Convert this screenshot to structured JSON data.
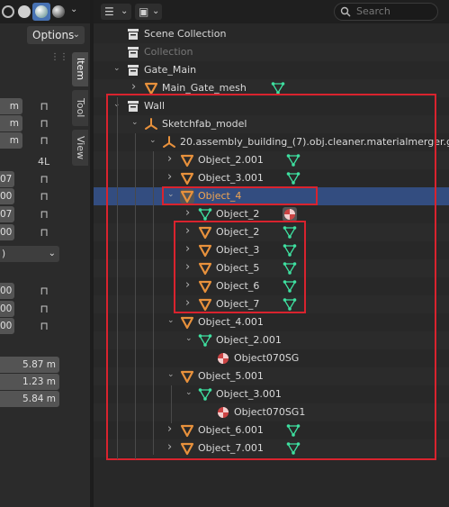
{
  "left_panel": {
    "options_label": "Options",
    "tabs": [
      "Item",
      "Tool",
      "View"
    ],
    "fields": {
      "loc": [
        "m",
        "m",
        "m"
      ],
      "rot_suffix": "4L",
      "rot": [
        "07",
        "00",
        "07",
        "00"
      ],
      "mode": ")",
      "scale": [
        "00",
        "00",
        "00"
      ],
      "dims": [
        "5.87 m",
        "1.23 m",
        "5.84 m"
      ]
    }
  },
  "outliner": {
    "search_placeholder": "Search",
    "rows": [
      {
        "label": "Scene Collection",
        "icon": "scene-collection-icon"
      },
      {
        "label": "Collection",
        "icon": "collection-icon",
        "dim": true
      },
      {
        "label": "Gate_Main",
        "icon": "collection-icon"
      },
      {
        "label": "Main_Gate_mesh",
        "icon": "object-icon",
        "data_icon": "mesh-icon"
      },
      {
        "label": "Wall",
        "icon": "collection-icon"
      },
      {
        "label": "Sketchfab_model",
        "icon": "empty-icon"
      },
      {
        "label": "20.assembly_building_(7).obj.cleaner.materialmerger.gle",
        "icon": "empty-icon"
      },
      {
        "label": "Object_2.001",
        "icon": "object-icon",
        "data_icon": "mesh-icon"
      },
      {
        "label": "Object_3.001",
        "icon": "object-icon",
        "data_icon": "mesh-icon"
      },
      {
        "label": "Object_4",
        "icon": "object-icon",
        "selected": true
      },
      {
        "label": "Object_2",
        "icon": "mesh-icon",
        "data_icon": "material-icon"
      },
      {
        "label": "Object_2",
        "icon": "object-icon",
        "data_icon": "mesh-icon"
      },
      {
        "label": "Object_3",
        "icon": "object-icon",
        "data_icon": "mesh-icon"
      },
      {
        "label": "Object_5",
        "icon": "object-icon",
        "data_icon": "mesh-icon"
      },
      {
        "label": "Object_6",
        "icon": "object-icon",
        "data_icon": "mesh-icon"
      },
      {
        "label": "Object_7",
        "icon": "object-icon",
        "data_icon": "mesh-icon"
      },
      {
        "label": "Object_4.001",
        "icon": "object-icon"
      },
      {
        "label": "Object_2.001",
        "icon": "mesh-icon"
      },
      {
        "label": "Object070SG",
        "icon": "material-icon"
      },
      {
        "label": "Object_5.001",
        "icon": "object-icon"
      },
      {
        "label": "Object_3.001",
        "icon": "mesh-icon"
      },
      {
        "label": "Object070SG1",
        "icon": "material-icon"
      },
      {
        "label": "Object_6.001",
        "icon": "object-icon",
        "data_icon": "mesh-icon"
      },
      {
        "label": "Object_7.001",
        "icon": "object-icon",
        "data_icon": "mesh-icon"
      }
    ]
  },
  "colors": {
    "selection": "#334d80",
    "highlight_box": "#d9232e",
    "object_orange": "#e8913c",
    "mesh_green": "#3ee0a0",
    "active_text": "#f0a552"
  }
}
